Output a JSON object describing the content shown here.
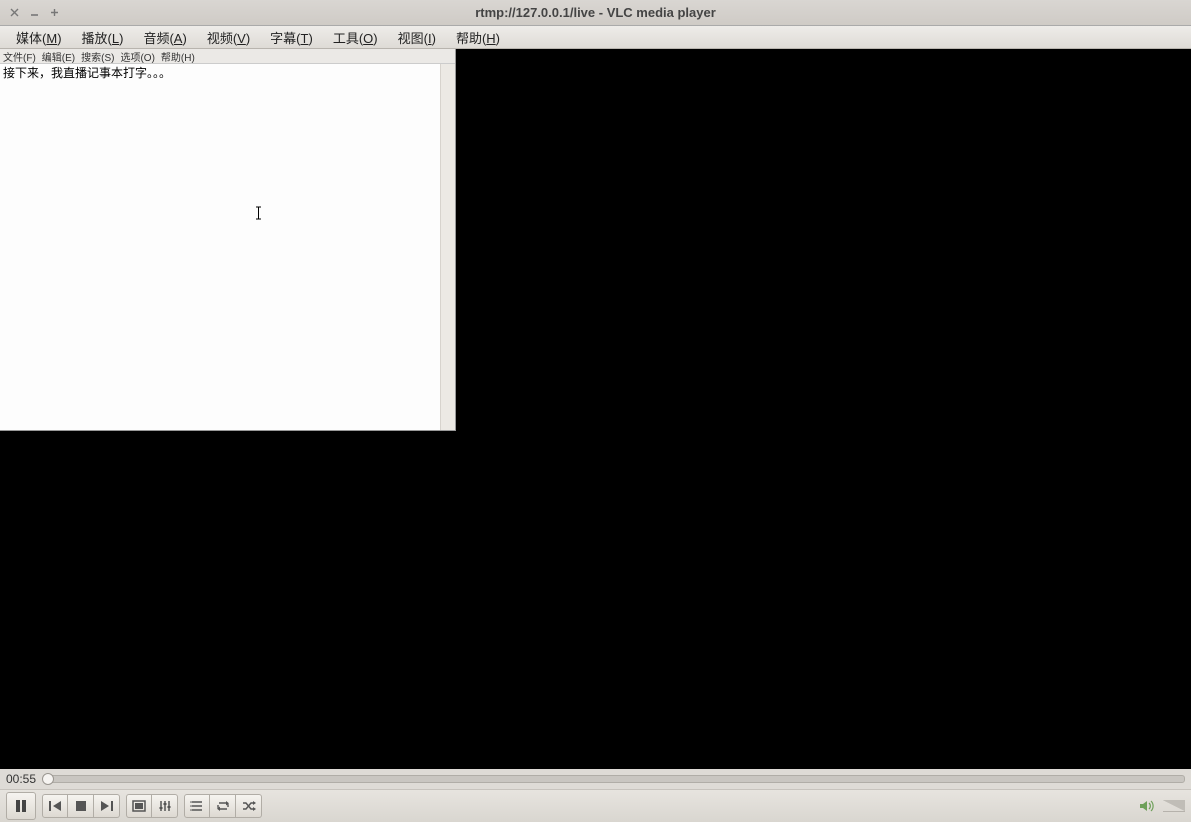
{
  "window": {
    "title": "rtmp://127.0.0.1/live - VLC media player"
  },
  "vlc_menu": {
    "media": {
      "label": "媒体(",
      "hotkey": "M",
      "tail": ")"
    },
    "playback": {
      "label": "播放(",
      "hotkey": "L",
      "tail": ")"
    },
    "audio": {
      "label": "音频(",
      "hotkey": "A",
      "tail": ")"
    },
    "video": {
      "label": "视频(",
      "hotkey": "V",
      "tail": ")"
    },
    "subtitle": {
      "label": "字幕(",
      "hotkey": "T",
      "tail": ")"
    },
    "tools": {
      "label": "工具(",
      "hotkey": "O",
      "tail": ")"
    },
    "view": {
      "label": "视图(",
      "hotkey": "I",
      "tail": ")"
    },
    "help": {
      "label": "帮助(",
      "hotkey": "H",
      "tail": ")"
    }
  },
  "notepad_menu": {
    "file": "文件(F)",
    "edit": "编辑(E)",
    "search": "搜索(S)",
    "options": "选项(O)",
    "help": "帮助(H)"
  },
  "notepad": {
    "text": "接下来，我直播记事本打字。。。"
  },
  "playback": {
    "elapsed": "00:55"
  }
}
